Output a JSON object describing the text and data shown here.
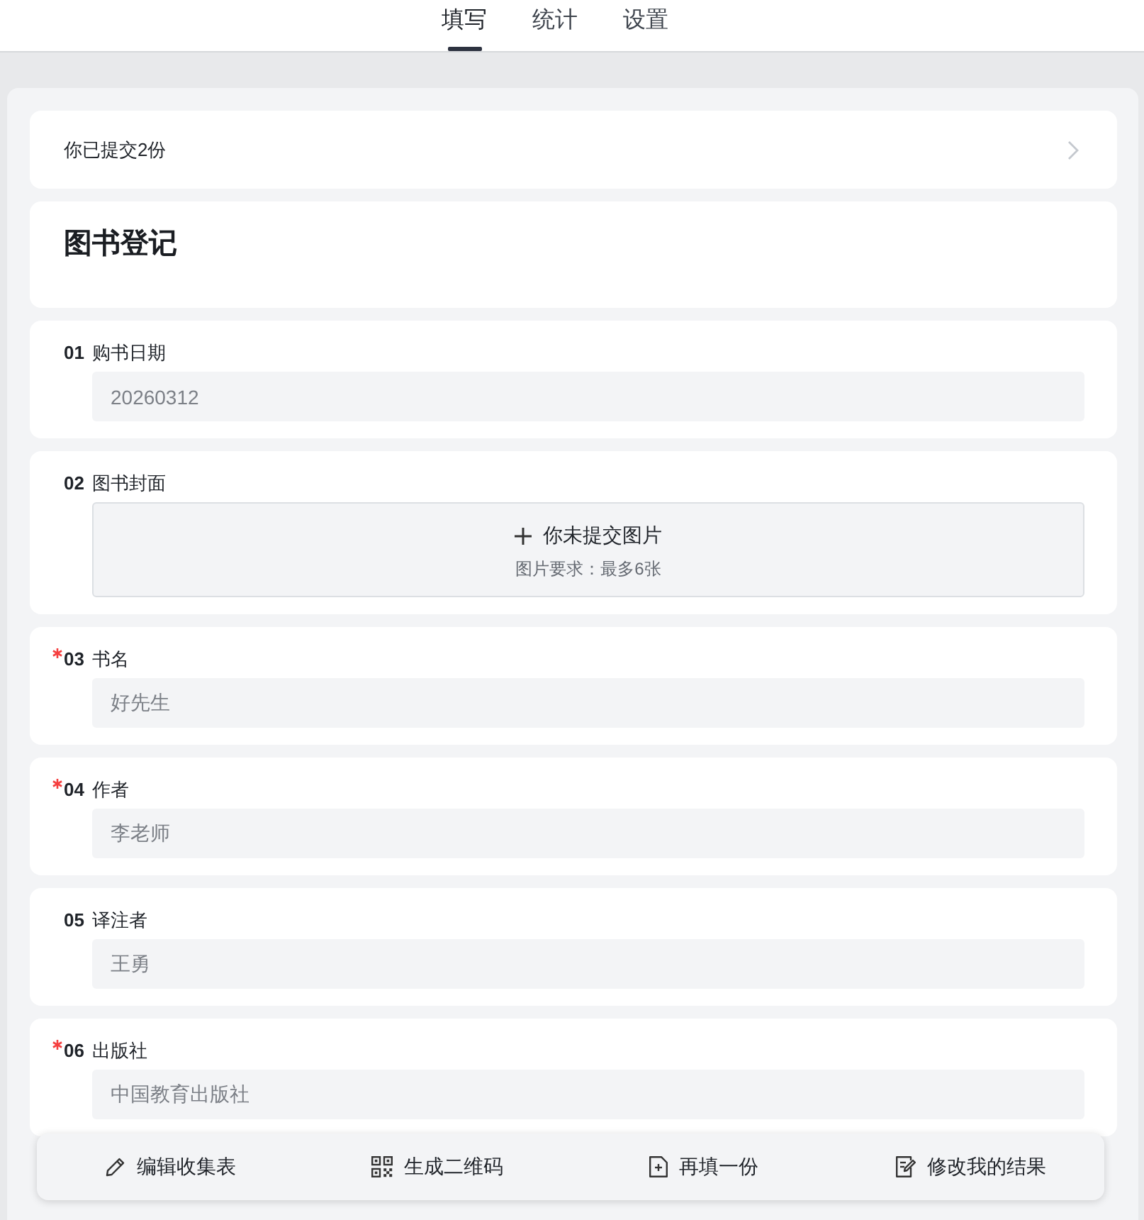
{
  "tabs": [
    {
      "label": "填写",
      "selected": true
    },
    {
      "label": "统计",
      "selected": false
    },
    {
      "label": "设置",
      "selected": false
    }
  ],
  "submissions": {
    "text": "你已提交2份"
  },
  "form": {
    "title": "图书登记"
  },
  "questions": [
    {
      "number": "01",
      "label": "购书日期",
      "required": false,
      "kind": "text",
      "value": "20260312"
    },
    {
      "number": "02",
      "label": "图书封面",
      "required": false,
      "kind": "upload",
      "prompt": "你未提交图片",
      "hint": "图片要求：最多6张"
    },
    {
      "number": "03",
      "label": "书名",
      "required": true,
      "kind": "text",
      "value": "好先生"
    },
    {
      "number": "04",
      "label": "作者",
      "required": true,
      "kind": "text",
      "value": "李老师"
    },
    {
      "number": "05",
      "label": "译注者",
      "required": false,
      "kind": "text",
      "value": "王勇"
    },
    {
      "number": "06",
      "label": "出版社",
      "required": true,
      "kind": "text",
      "value": "中国教育出版社"
    }
  ],
  "actions": [
    {
      "label": "编辑收集表"
    },
    {
      "label": "生成二维码"
    },
    {
      "label": "再填一份"
    },
    {
      "label": "修改我的结果"
    }
  ]
}
